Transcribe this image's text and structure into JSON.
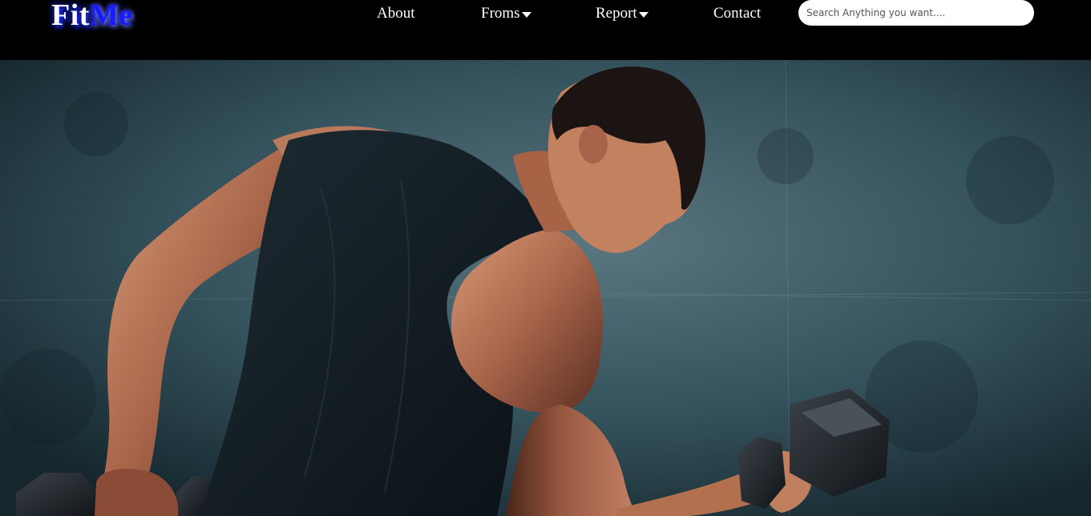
{
  "logo": {
    "part1": "Fit",
    "part2": "Me"
  },
  "nav": {
    "about": "About",
    "froms": "Froms",
    "report": "Report",
    "contact": "Contact"
  },
  "search": {
    "placeholder": "Search Anything you want...."
  },
  "hero": {
    "image_subject": "man lifting dumbbells in front of concrete wall"
  }
}
